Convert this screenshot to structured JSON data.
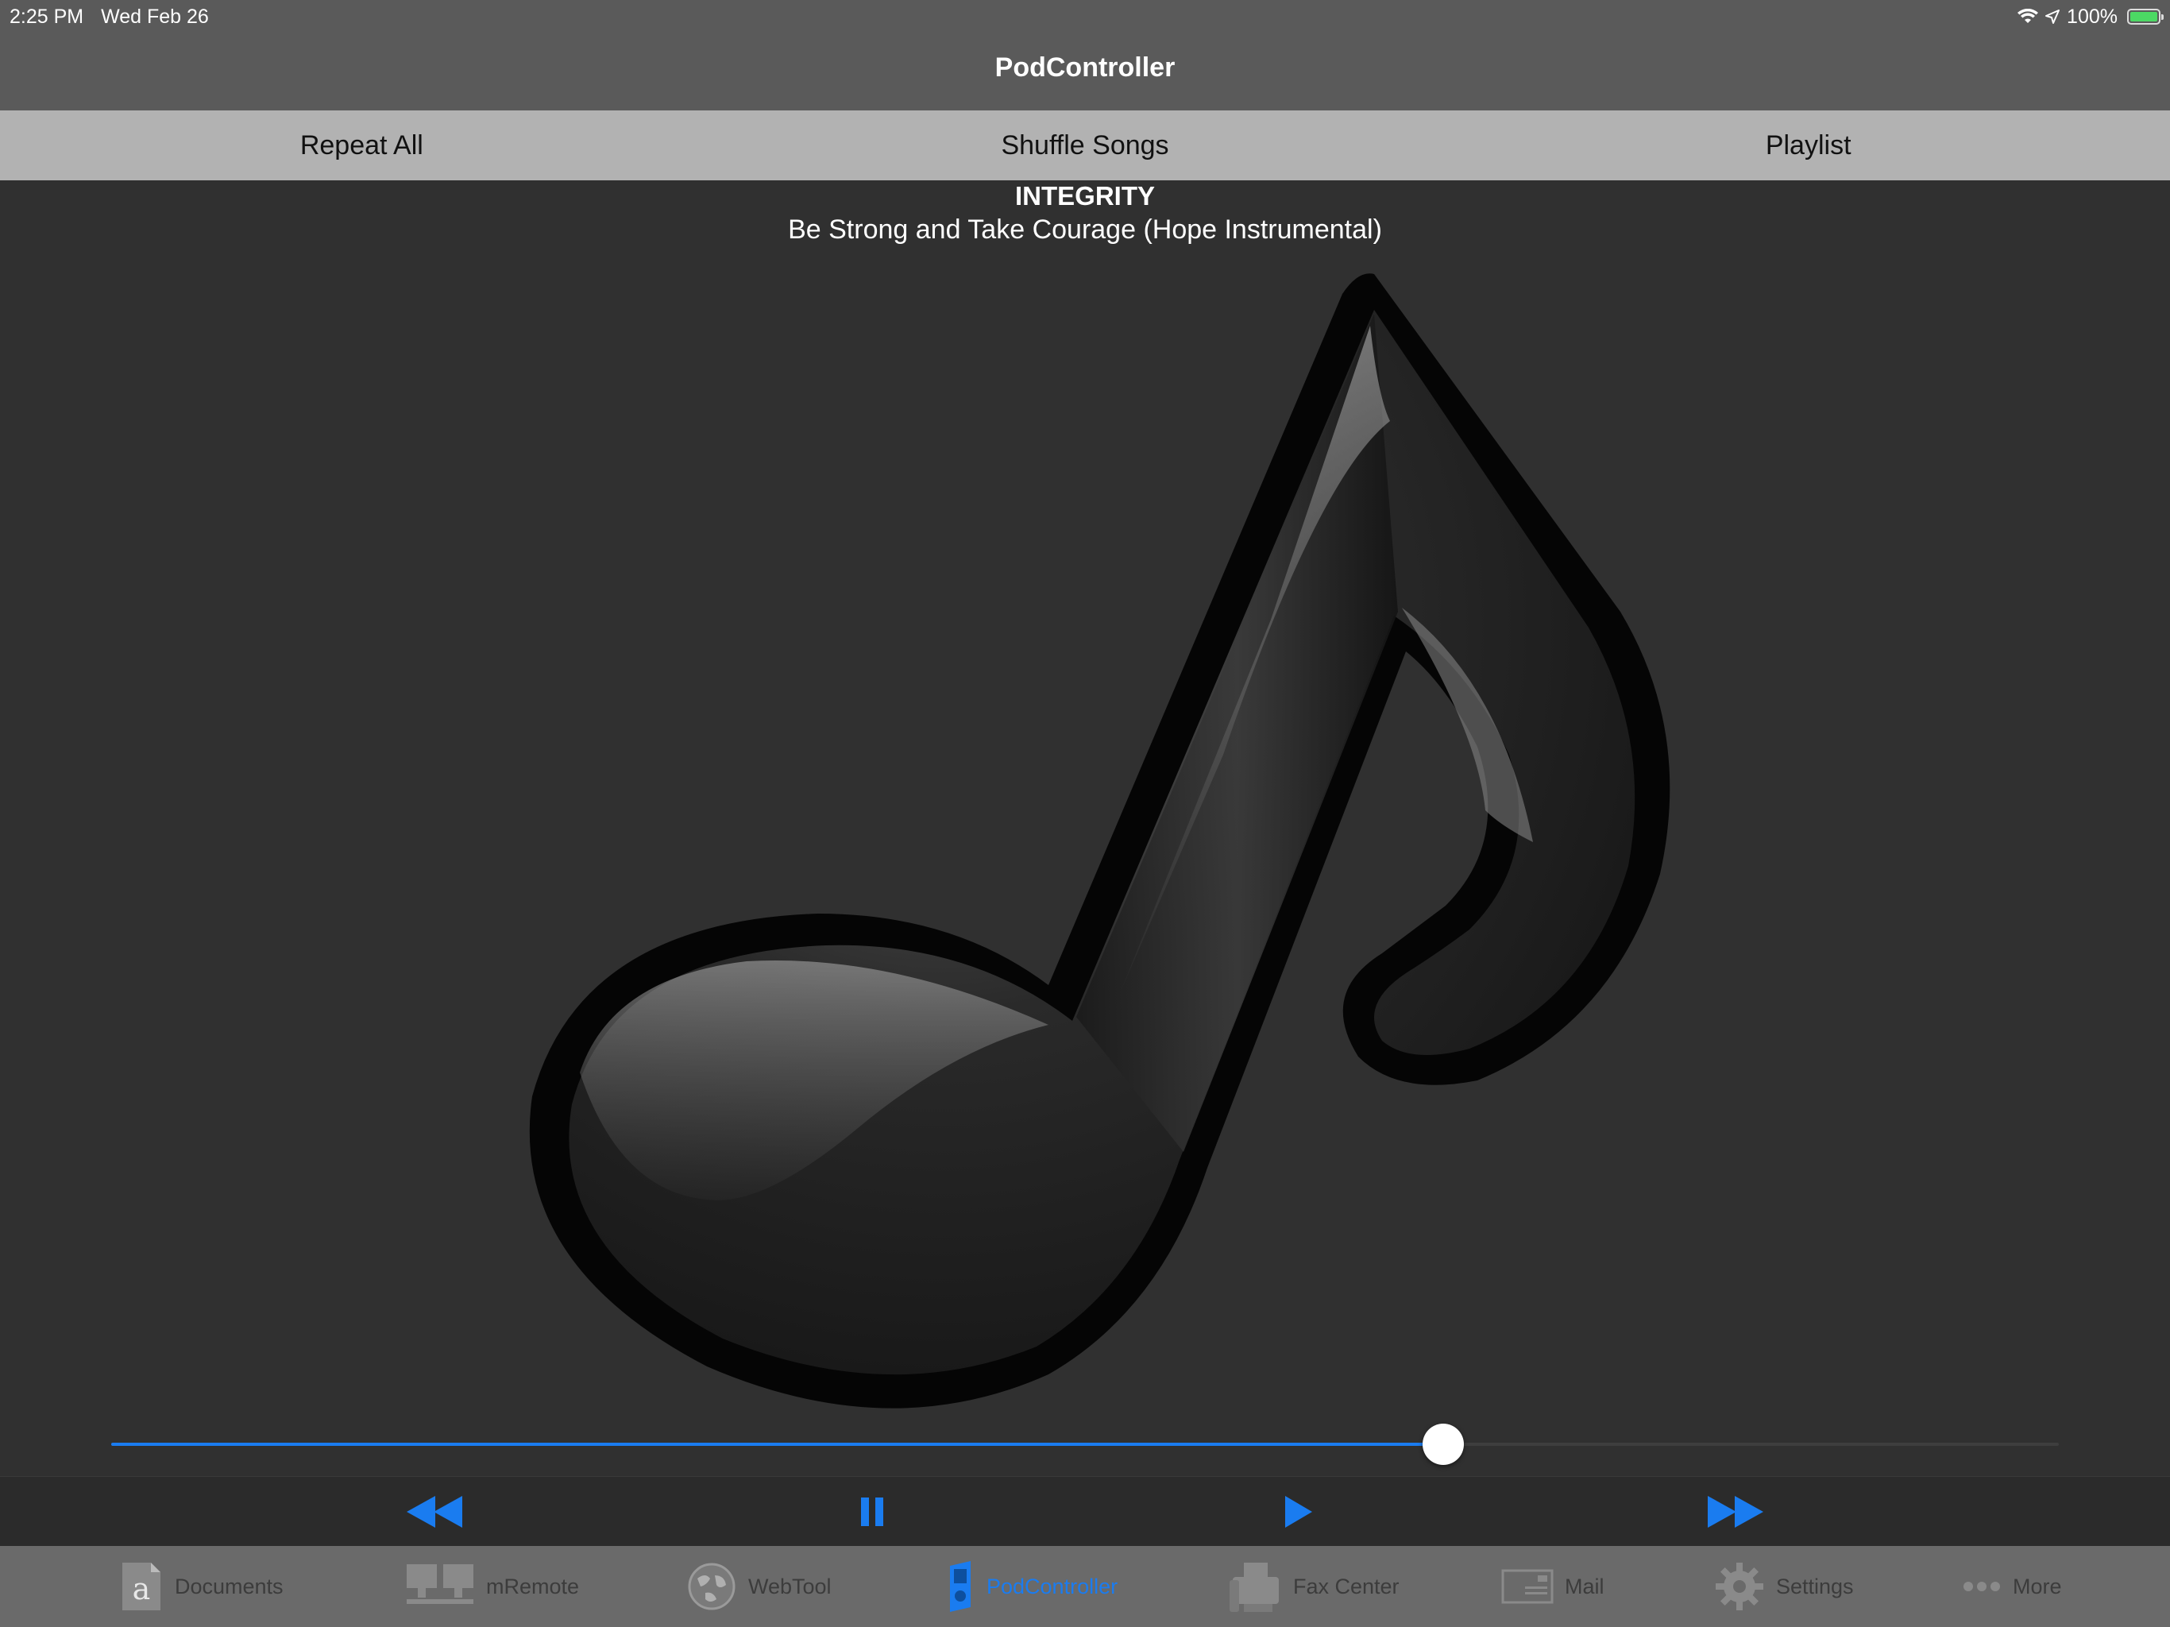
{
  "status_bar": {
    "time": "2:25 PM",
    "date": "Wed Feb 26",
    "battery": "100%",
    "icons": [
      "wifi-icon",
      "location-icon",
      "battery-icon"
    ]
  },
  "nav": {
    "title": "PodController"
  },
  "toolbar": {
    "repeat": "Repeat All",
    "shuffle": "Shuffle Songs",
    "playlist": "Playlist"
  },
  "now_playing": {
    "artist": "INTEGRITY",
    "song": "Be Strong and Take Courage (Hope Instrumental)",
    "artwork": "music-note-icon",
    "progress": 0.684
  },
  "transport": {
    "buttons": [
      "rewind-icon",
      "pause-icon",
      "play-icon",
      "fast-forward-icon"
    ]
  },
  "tabs": [
    {
      "label": "Documents",
      "icon": "documents-icon"
    },
    {
      "label": "mRemote",
      "icon": "remote-desktop-icon"
    },
    {
      "label": "WebTool",
      "icon": "globe-icon"
    },
    {
      "label": "PodController",
      "icon": "ipod-icon",
      "active": true
    },
    {
      "label": "Fax Center",
      "icon": "fax-icon"
    },
    {
      "label": "Mail",
      "icon": "mail-icon"
    },
    {
      "label": "Settings",
      "icon": "gear-icon"
    },
    {
      "label": "More",
      "icon": "more-icon"
    }
  ],
  "colors": {
    "accent": "#1a7cf0",
    "nav": "#5a5a5a",
    "toolbar": "#b2b2b2",
    "background": "#303030",
    "tabbar": "#6a6a6a"
  }
}
